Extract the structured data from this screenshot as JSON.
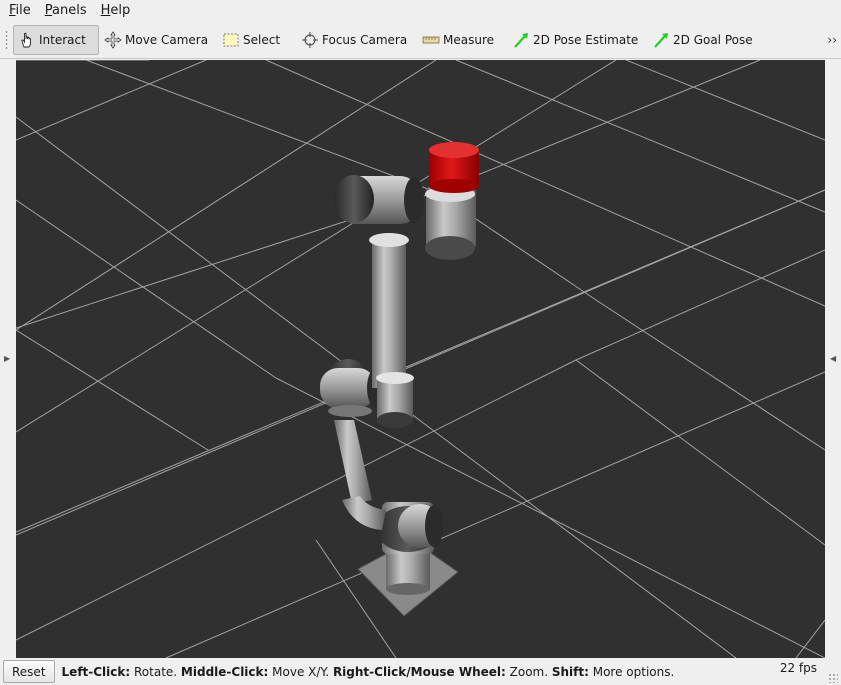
{
  "menu": {
    "items": [
      {
        "mnemonic": "F",
        "rest": "ile"
      },
      {
        "mnemonic": "P",
        "rest": "anels"
      },
      {
        "mnemonic": "H",
        "rest": "elp"
      }
    ]
  },
  "toolbar": {
    "interact": "Interact",
    "move_camera": "Move Camera",
    "select": "Select",
    "focus_camera": "Focus Camera",
    "measure": "Measure",
    "pose_estimate": "2D Pose Estimate",
    "goal_pose": "2D Goal Pose",
    "overflow": "››",
    "active_tool": "Interact"
  },
  "colors": {
    "viewport_bg": "#303030",
    "grid": "#a0a0a0",
    "robot_link": "#9d9d9d",
    "robot_joint": "#3c3c3c",
    "end_effector": "#d01010",
    "pose_arrow": "#22cc22"
  },
  "statusbar": {
    "reset_label": "Reset",
    "hints": [
      {
        "key": "Left-Click:",
        "action": " Rotate. "
      },
      {
        "key": "Middle-Click:",
        "action": " Move X/Y. "
      },
      {
        "key": "Right-Click/Mouse Wheel:",
        "action": " Zoom. "
      },
      {
        "key": "Shift:",
        "action": " More options."
      }
    ],
    "fps": "22 fps"
  }
}
